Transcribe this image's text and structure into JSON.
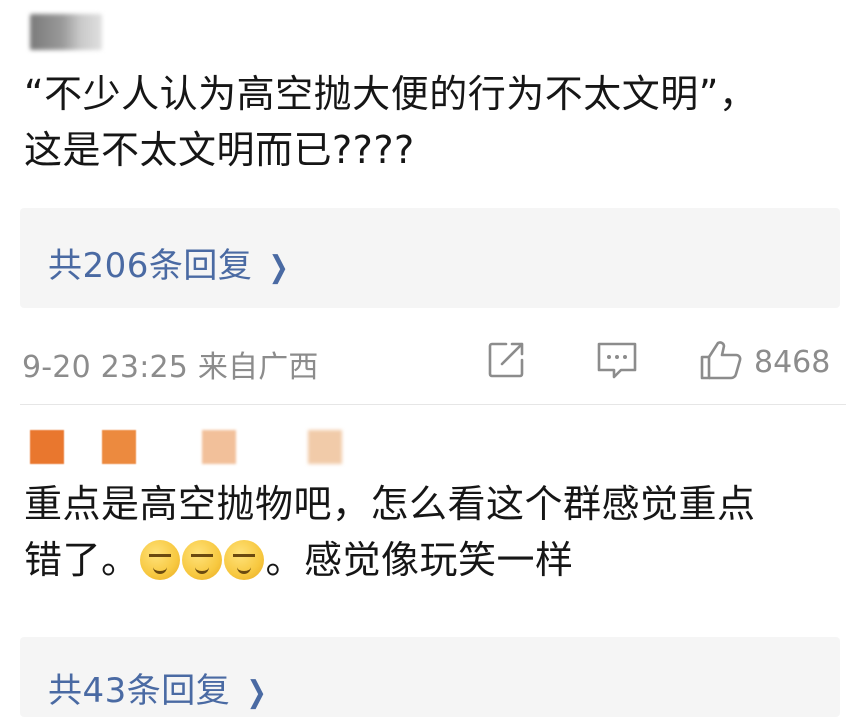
{
  "comments": [
    {
      "text": "“不少人认为高空抛大便的行为不太文明”，\n这是不太文明而已????",
      "replies_label": "共206条回复",
      "timestamp": "9-20 23:25 来自广西",
      "like_count": "8468"
    },
    {
      "text_before_emoji": "重点是高空抛物吧，怎么看这个群感觉重点\n错了。",
      "text_after_emoji": "。感觉像玩笑一样",
      "replies_label": "共43条回复"
    }
  ],
  "icons": {
    "chevron": "chevron-right-icon",
    "share": "share-edit-icon",
    "reply": "comment-icon",
    "like": "thumbs-up-icon"
  },
  "colors": {
    "link": "#4a6aa3",
    "meta": "#8c8c8c",
    "reply_box_bg": "#f5f5f5"
  }
}
